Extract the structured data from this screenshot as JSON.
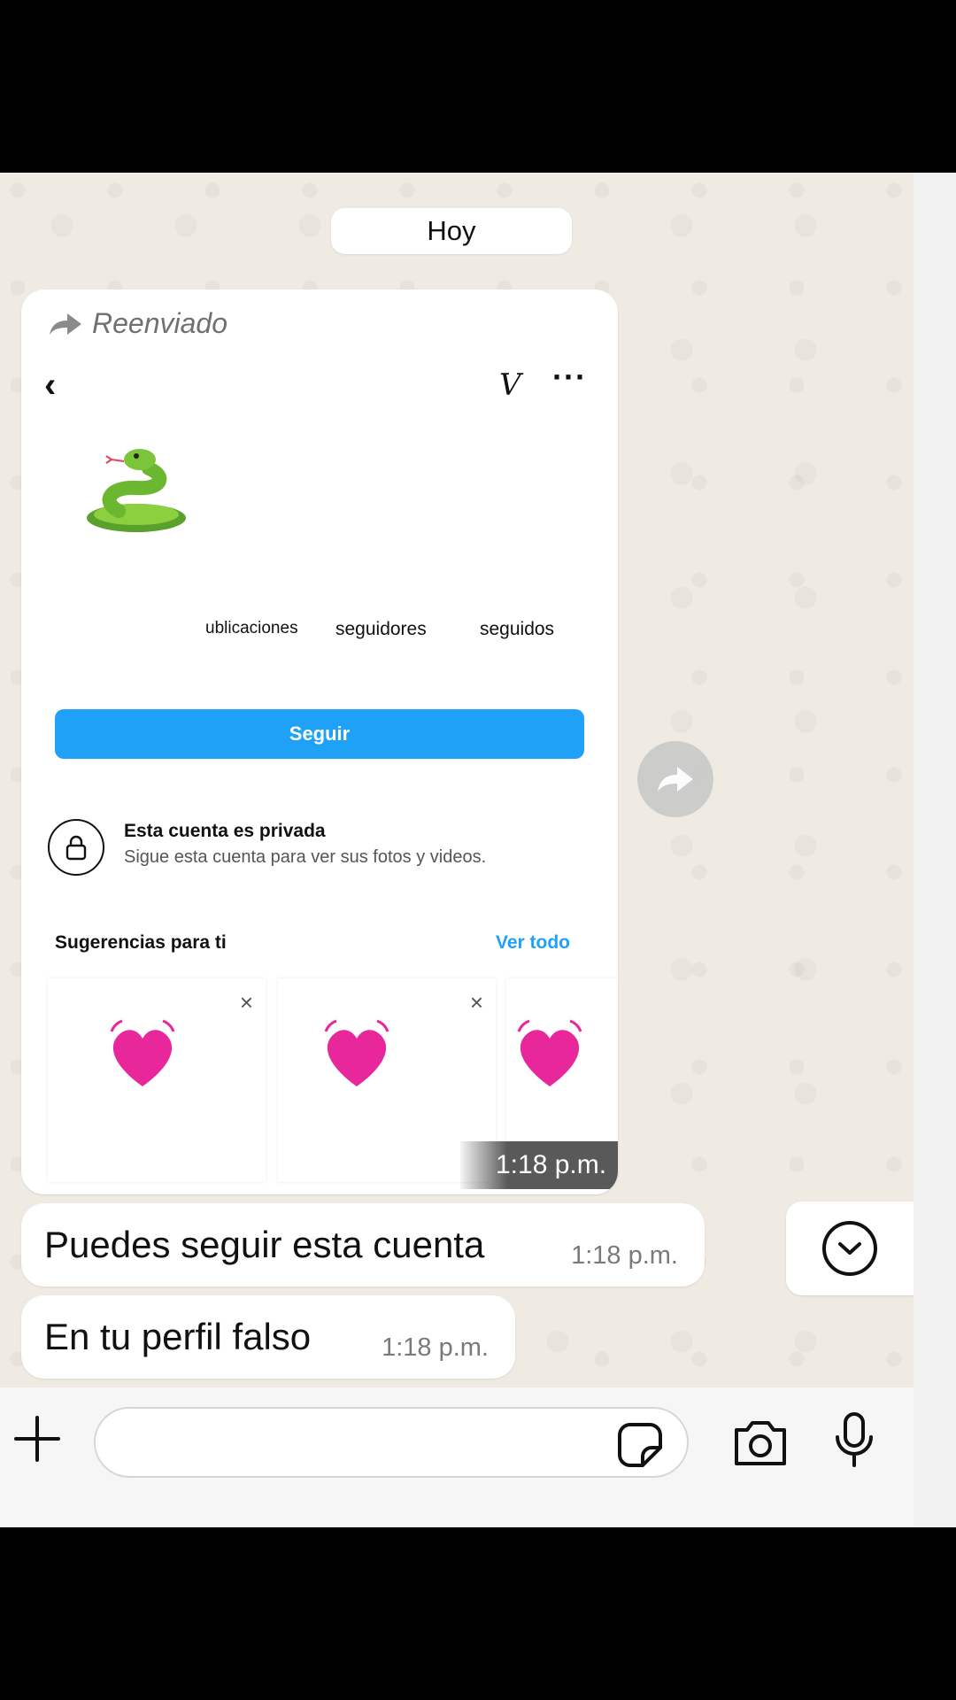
{
  "chat": {
    "date_label": "Hoy",
    "forwarded_label": "Reenviado",
    "shared_profile": {
      "back_glyph": "‹",
      "header_glyph": "V",
      "more_glyph": "···",
      "stats": [
        "ublicaciones",
        "seguidores",
        "seguidos"
      ],
      "follow_label": "Seguir",
      "private_title": "Esta cuenta es privada",
      "private_subtitle": "Sigue esta cuenta para ver sus fotos y videos.",
      "suggestions_title": "Sugerencias para ti",
      "see_all_label": "Ver todo",
      "dismiss_glyph": "×"
    },
    "media_time": "1:18 p.m.",
    "messages": [
      {
        "text": "Puedes seguir esta cuenta",
        "time": "1:18 p.m."
      },
      {
        "text": "En tu perfil falso",
        "time": "1:18 p.m."
      }
    ]
  },
  "input": {
    "placeholder": ""
  },
  "colors": {
    "chat_background": "#efeae2",
    "instagram_blue": "#1ea1f7",
    "bubble": "#ffffff"
  },
  "icons": [
    "forward-arrow-icon",
    "snake-emoji",
    "lock-icon",
    "heart-emoji",
    "share-arrow-icon",
    "chevron-down-icon",
    "plus-icon",
    "sticker-icon",
    "camera-icon",
    "microphone-icon"
  ]
}
